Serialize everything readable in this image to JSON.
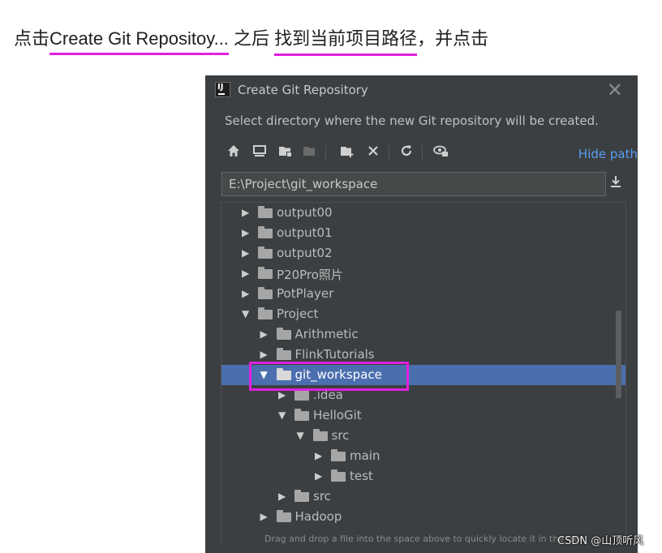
{
  "caption": {
    "part1": "点击",
    "part2": "Create Git Repositoy...",
    "part3": " 之后 ",
    "part4": "找到当前项目路径",
    "part5": "，并点击",
    "highlight_color": "#e020e0"
  },
  "dialog": {
    "title": "Create Git Repository",
    "app_icon_text": "IJ",
    "description": "Select directory where the new Git repository will be created.",
    "toolbar": {
      "icons": [
        "home-icon",
        "desktop-icon",
        "project-folder-icon",
        "module-folder-icon",
        "new-folder-icon",
        "delete-icon",
        "refresh-icon",
        "show-hidden-icon"
      ],
      "hide_path_label": "Hide path"
    },
    "path_value": "E:\\Project\\git_workspace",
    "tree": [
      {
        "label": "output00",
        "depth": 0,
        "expanded": false
      },
      {
        "label": "output01",
        "depth": 0,
        "expanded": false
      },
      {
        "label": "output02",
        "depth": 0,
        "expanded": false
      },
      {
        "label": "P20Pro照片",
        "depth": 0,
        "expanded": false
      },
      {
        "label": "PotPlayer",
        "depth": 0,
        "expanded": false
      },
      {
        "label": "Project",
        "depth": 0,
        "expanded": true
      },
      {
        "label": "Arithmetic",
        "depth": 1,
        "expanded": false
      },
      {
        "label": "FlinkTutorials",
        "depth": 1,
        "expanded": false
      },
      {
        "label": "git_workspace",
        "depth": 1,
        "expanded": true,
        "selected": true
      },
      {
        "label": ".idea",
        "depth": 2,
        "expanded": false
      },
      {
        "label": "HelloGit",
        "depth": 2,
        "expanded": true
      },
      {
        "label": "src",
        "depth": 3,
        "expanded": true
      },
      {
        "label": "main",
        "depth": 4,
        "expanded": false
      },
      {
        "label": "test",
        "depth": 4,
        "expanded": false
      },
      {
        "label": "src",
        "depth": 2,
        "expanded": false
      },
      {
        "label": "Hadoop",
        "depth": 1,
        "expanded": false
      }
    ],
    "footer_hint": "Drag and drop a file into the space above to quickly locate it in the tree"
  },
  "watermark": "CSDN @山顶听风",
  "colors": {
    "dialog_bg": "#3c3f41",
    "selection": "#4b6eaf",
    "link": "#589df6"
  }
}
